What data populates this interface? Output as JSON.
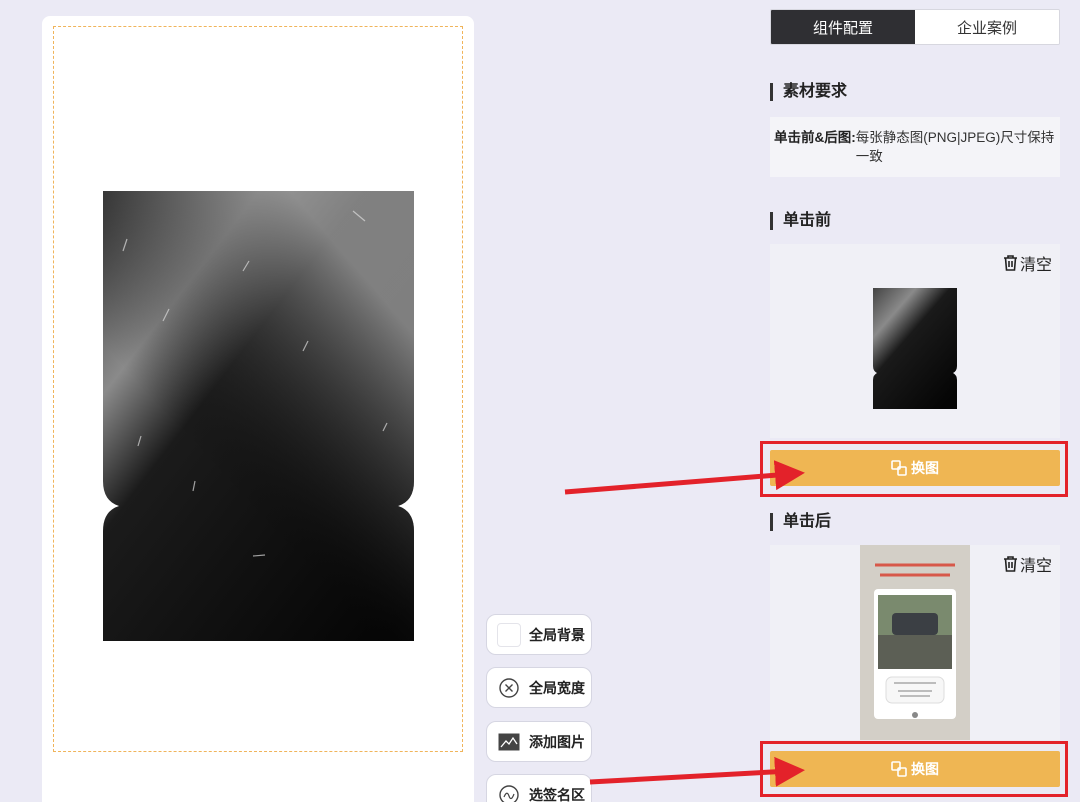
{
  "tools": {
    "global_background": "全局背景",
    "global_width": "全局宽度",
    "add_image": "添加图片",
    "signature_area": "选签名区"
  },
  "tabs": [
    {
      "label": "组件配置",
      "active": true
    },
    {
      "label": "企业案例",
      "active": false
    }
  ],
  "material": {
    "title": "素材要求",
    "label": "单击前&后图:",
    "value": "每张静态图(PNG|JPEG)尺寸保持一致"
  },
  "before": {
    "title": "单击前",
    "clear_label": "清空",
    "swap_label": "换图"
  },
  "after": {
    "title": "单击后",
    "clear_label": "清空",
    "swap_label": "换图"
  },
  "icons": [
    "close-circle-icon",
    "image-icon",
    "signature-icon",
    "trash-icon",
    "swap-image-icon"
  ],
  "colors": {
    "accent": "#efb653",
    "tab_active": "#2f2f33",
    "annotation": "#e3222a",
    "page_bg": "#ebeaf5"
  }
}
